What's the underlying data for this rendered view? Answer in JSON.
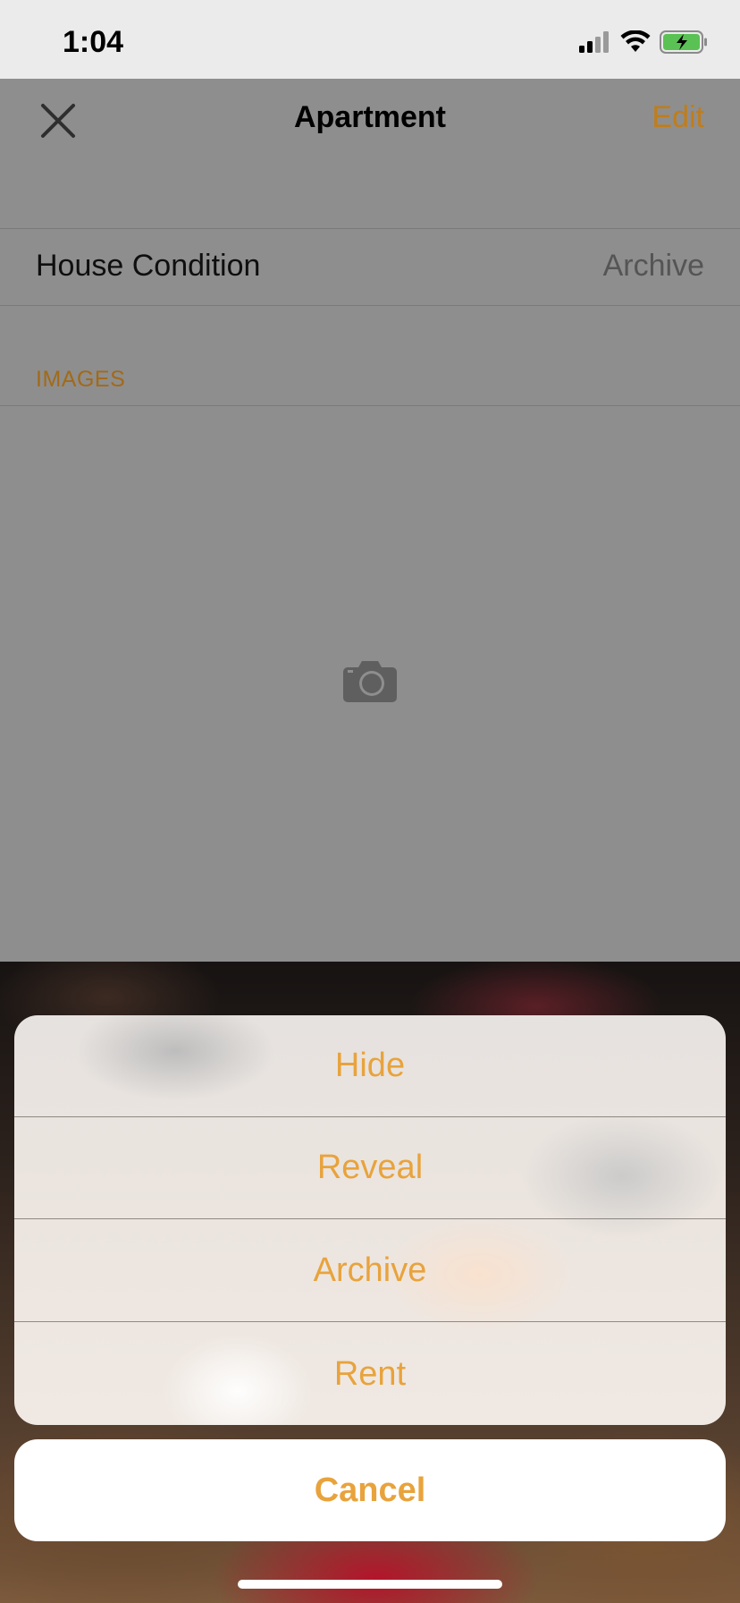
{
  "status_bar": {
    "time": "1:04",
    "icons": [
      "signal-icon",
      "wifi-icon",
      "battery-charging-icon"
    ]
  },
  "navbar": {
    "title": "Apartment",
    "edit_label": "Edit",
    "close_icon": "close-icon"
  },
  "details": {
    "row_label": "House Condition",
    "row_value": "Archive"
  },
  "images_section": {
    "header": "IMAGES",
    "placeholder_icon": "camera-icon"
  },
  "action_sheet": {
    "actions": [
      {
        "label": "Hide"
      },
      {
        "label": "Reveal"
      },
      {
        "label": "Archive"
      },
      {
        "label": "Rent"
      }
    ],
    "cancel_label": "Cancel"
  },
  "colors": {
    "accent": "#e8a33c",
    "accent_dimmed": "#c07d1a",
    "overlay_gray": "#8e8e8e",
    "status_bar_bg": "#ebebeb"
  }
}
